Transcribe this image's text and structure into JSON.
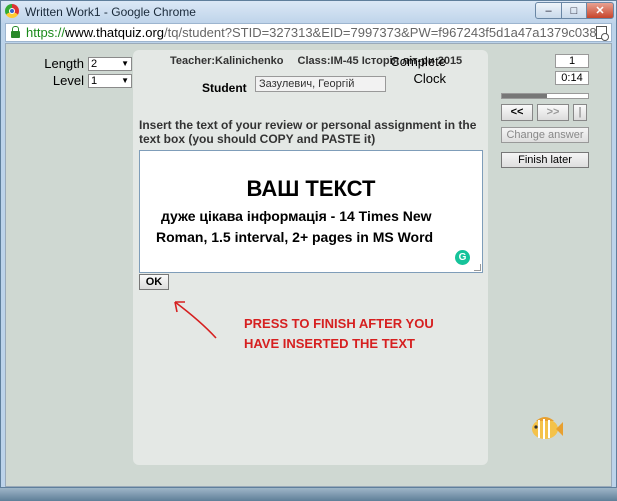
{
  "window": {
    "title": "Written Work1 - Google Chrome",
    "buttons": {
      "minimize": "–",
      "maximize": "□",
      "close": "✕"
    }
  },
  "address": {
    "scheme": "https://",
    "host": "www.thatquiz.org",
    "path": "/tq/student?STID=327313&EID=7997373&PW=f967243f5d1a47a1379c0386b5f1"
  },
  "controls": {
    "length_label": "Length",
    "length_value": "2",
    "level_label": "Level",
    "level_value": "1"
  },
  "header": {
    "teacher": "Teacher:Kalinichenko",
    "class": "Class:IM-45 Історія літ-ри 2015"
  },
  "student": {
    "label": "Student",
    "name": "Зазулевич, Георгій"
  },
  "instructions": "Insert the text of your review or personal assignment in the text box (you should COPY and PASTE it)",
  "textbox": {
    "heading": "ВАШ ТЕКСТ",
    "line1": "дуже цікава інформація - 14 Times New",
    "line2": "Roman, 1.5 interval, 2+ pages in MS Word",
    "grammarly": "G"
  },
  "ok_label": "OK",
  "hint_text": "PRESS TO FINISH AFTER YOU HAVE INSERTED THE TEXT",
  "status": {
    "complete_label": "Complete",
    "complete_value": "1",
    "clock_label": "Clock",
    "clock_value": "0:14",
    "progress_fraction": 0.52
  },
  "nav": {
    "prev": "<<",
    "next": ">>",
    "end": "|",
    "change_answer": "Change answer",
    "finish_later": "Finish later"
  },
  "colors": {
    "hint_red": "#d62020",
    "secure_green": "#1a8a1a",
    "panel_bg": "#e4e8e5",
    "page_bg": "#cfd8d2"
  }
}
